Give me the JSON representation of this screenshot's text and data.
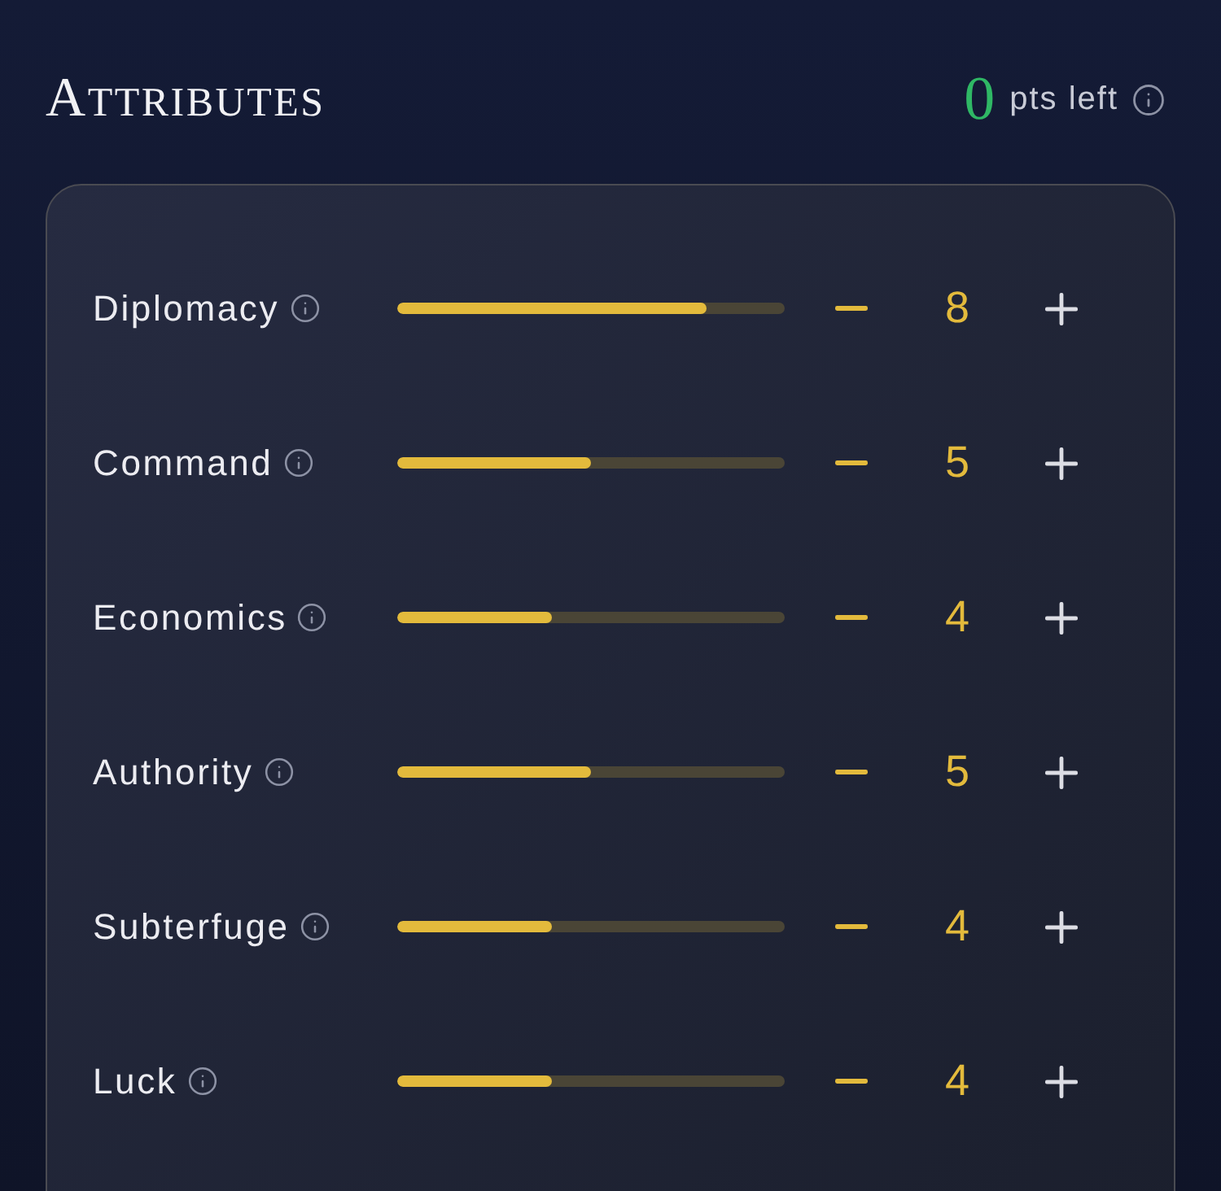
{
  "header": {
    "title": "ATTRIBUTES",
    "points": "0",
    "points_label": "pts left"
  },
  "attributes": [
    {
      "name": "Diplomacy",
      "level": 0.8,
      "value": "8"
    },
    {
      "name": "Command",
      "level": 0.5,
      "value": "5"
    },
    {
      "name": "Economics",
      "level": 0.4,
      "value": "4"
    },
    {
      "name": "Authority",
      "level": 0.5,
      "value": "5"
    },
    {
      "name": "Subterfuge",
      "level": 0.4,
      "value": "4"
    },
    {
      "name": "Luck",
      "level": 0.4,
      "value": "4"
    }
  ]
}
